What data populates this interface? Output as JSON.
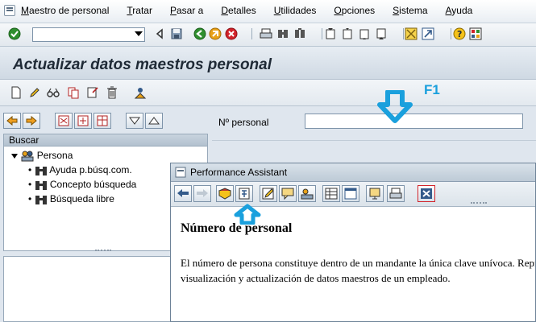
{
  "menu": {
    "items": [
      {
        "mnemonic": "M",
        "rest": "aestro de personal"
      },
      {
        "mnemonic": "T",
        "rest": "ratar"
      },
      {
        "mnemonic": "P",
        "rest": "asar a"
      },
      {
        "mnemonic": "D",
        "rest": "etalles"
      },
      {
        "mnemonic": "U",
        "rest": "tilidades"
      },
      {
        "mnemonic": "O",
        "rest": "pciones"
      },
      {
        "mnemonic": "S",
        "rest": "istema"
      },
      {
        "mnemonic": "A",
        "rest": "yuda"
      }
    ]
  },
  "toolbar": {
    "command_value": ""
  },
  "title": {
    "text": "Actualizar datos maestros personal"
  },
  "left_pane": {
    "search_header": "Buscar",
    "tree_root": "Persona",
    "tree_children": [
      "Ayuda p.búsq.com.",
      "Concepto búsqueda",
      "Búsqueda libre"
    ]
  },
  "main": {
    "personnel_label": "Nº personal",
    "personnel_value": ""
  },
  "annotation": {
    "key_label": "F1",
    "color": "#1aa0dd"
  },
  "performance_assistant": {
    "title": "Performance Assistant",
    "heading": "Número de personal",
    "paragraph": "El número de persona constituye dentro de un mandante la única clave unívoca. Representa el acceso para la visualización y actualización de datos maestros de un empleado."
  }
}
